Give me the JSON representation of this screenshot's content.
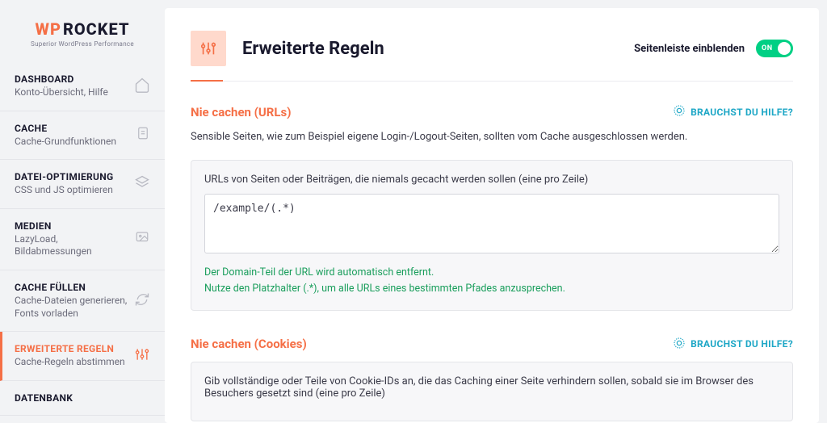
{
  "logo": {
    "wp": "WP",
    "rocket": "ROCKET",
    "tagline": "Superior WordPress Performance"
  },
  "nav": [
    {
      "title": "DASHBOARD",
      "desc": "Konto-Übersicht, Hilfe"
    },
    {
      "title": "CACHE",
      "desc": "Cache-Grundfunktionen"
    },
    {
      "title": "DATEI-OPTIMIERUNG",
      "desc": "CSS und JS optimieren"
    },
    {
      "title": "MEDIEN",
      "desc": "LazyLoad, Bildabmessungen"
    },
    {
      "title": "CACHE FÜLLEN",
      "desc": "Cache-Dateien generieren, Fonts vorladen"
    },
    {
      "title": "ERWEITERTE REGELN",
      "desc": "Cache-Regeln abstimmen"
    },
    {
      "title": "DATENBANK",
      "desc": ""
    }
  ],
  "page": {
    "title": "Erweiterte Regeln"
  },
  "header": {
    "sidebar_toggle_label": "Seitenleiste einblenden",
    "toggle_state": "ON"
  },
  "help_label": "BRAUCHST DU HILFE?",
  "section_urls": {
    "title": "Nie cachen (URLs)",
    "desc": "Sensible Seiten, wie zum Beispiel eigene Login-/Logout-Seiten, sollten vom Cache ausgeschlossen werden.",
    "field_label": "URLs von Seiten oder Beiträgen, die niemals gecacht werden sollen (eine pro Zeile)",
    "value": "/example/(.*)",
    "hint1": "Der Domain-Teil der URL wird automatisch entfernt.",
    "hint2": "Nutze den Platzhalter (.*), um alle URLs eines bestimmten Pfades anzusprechen."
  },
  "section_cookies": {
    "title": "Nie cachen (Cookies)",
    "field_label": "Gib vollständige oder Teile von Cookie-IDs an, die das Caching einer Seite verhindern sollen, sobald sie im Browser des Besuchers gesetzt sind (eine pro Zeile)"
  }
}
